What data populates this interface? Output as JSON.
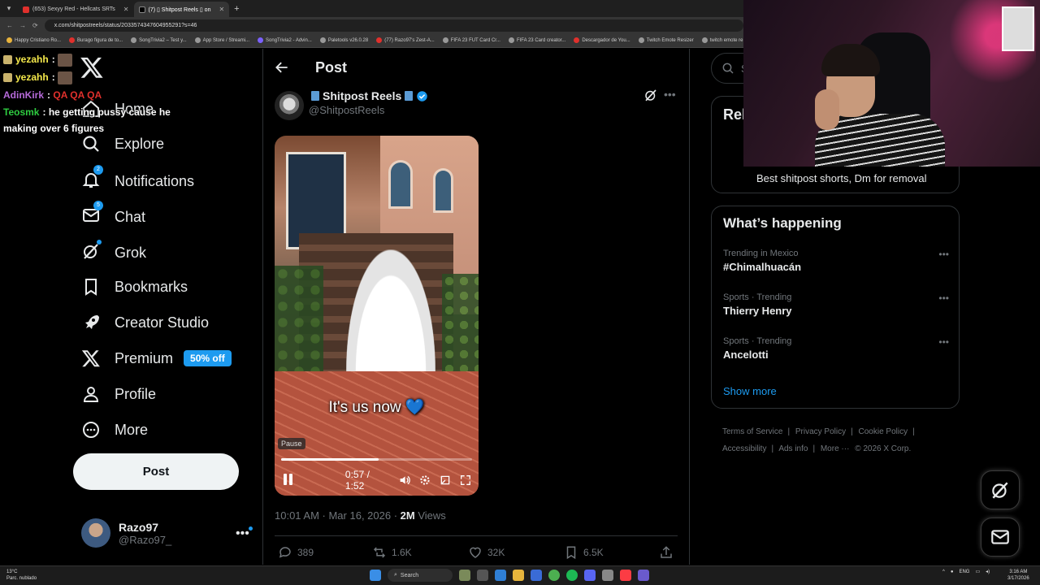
{
  "browser": {
    "tabs": [
      {
        "title": "(653) Sexyy Red - Hellcats SRTs",
        "active": false
      },
      {
        "title": "(7) ▯ Shitpost Reels ▯ on",
        "active": true
      }
    ],
    "url": "x.com/shitpostreels/status/2033574347604955291?s=46",
    "bookmarks": [
      "Happy Cristiano Ro...",
      "Burago figura de to...",
      "SongTrivia2 – Test y...",
      "App Store / Streami...",
      "SongTrivia2 - Advin...",
      "Paletools v26.0.28",
      "(77) Razo97's Zest-A...",
      "FIFA 23 FUT Card Cr...",
      "FIFA 23 Card creator...",
      "Descargador de You...",
      "Twitch Emote Resizer",
      "twitch emote re..."
    ]
  },
  "chat": [
    {
      "user": "yezahh",
      "color": "#f5e94b",
      "text": ""
    },
    {
      "user": "yezahh",
      "color": "#f5e94b",
      "text": ""
    },
    {
      "user": "AdinKirk",
      "color": "#b66ad9",
      "text": "QA QA QA",
      "text_color": "#e0302c"
    },
    {
      "user": "Teosmk",
      "color": "#2ecc40",
      "text": "he getting pussy cause he making over 6 figures",
      "text_color": "#ffffff"
    }
  ],
  "nav": {
    "home": "Home",
    "explore": "Explore",
    "notifications": "Notifications",
    "notifications_badge": "2",
    "chat": "Chat",
    "chat_badge": "5",
    "grok": "Grok",
    "bookmarks": "Bookmarks",
    "creator_studio": "Creator Studio",
    "premium": "Premium",
    "premium_badge": "50% off",
    "profile": "Profile",
    "more": "More",
    "post_button": "Post"
  },
  "account": {
    "name": "Razo97",
    "handle": "@Razo97_"
  },
  "post": {
    "header_title": "Post",
    "author_name": "Shitpost Reels",
    "author_handle": "@ShitpostReels",
    "video": {
      "caption": "It's us now 💙",
      "tooltip": "Pause",
      "time": "0:57 / 1:52",
      "progress": 0.51
    },
    "timestamp": "10:01 AM · Mar 16, 2026 · ",
    "views_count": "2M",
    "views_label": " Views",
    "actions": {
      "replies": "389",
      "reposts": "1.6K",
      "likes": "32K",
      "bookmarks": "6.5K"
    }
  },
  "sidebar": {
    "search_placeholder": "Se",
    "relevant_title": "Rel",
    "relevant_desc": "Best shitpost shorts, Dm for removal",
    "happening_title": "What’s happening",
    "trends": [
      {
        "category": "Trending in Mexico",
        "name": "#Chimalhuacán"
      },
      {
        "category": "Sports · Trending",
        "name": "Thierry Henry"
      },
      {
        "category": "Sports · Trending",
        "name": "Ancelotti"
      }
    ],
    "show_more": "Show more",
    "footer": [
      "Terms of Service",
      "Privacy Policy",
      "Cookie Policy",
      "Accessibility",
      "Ads info",
      "More ···",
      "© 2026 X Corp."
    ]
  },
  "taskbar": {
    "temp": "13°C",
    "weather": "Parc. nublado",
    "search": "Search",
    "lang": "ENG",
    "time": "3:16 AM",
    "date": "3/17/2026"
  },
  "colors": {
    "accent": "#1d9bf0",
    "bg": "#000000",
    "muted": "#71767b"
  }
}
